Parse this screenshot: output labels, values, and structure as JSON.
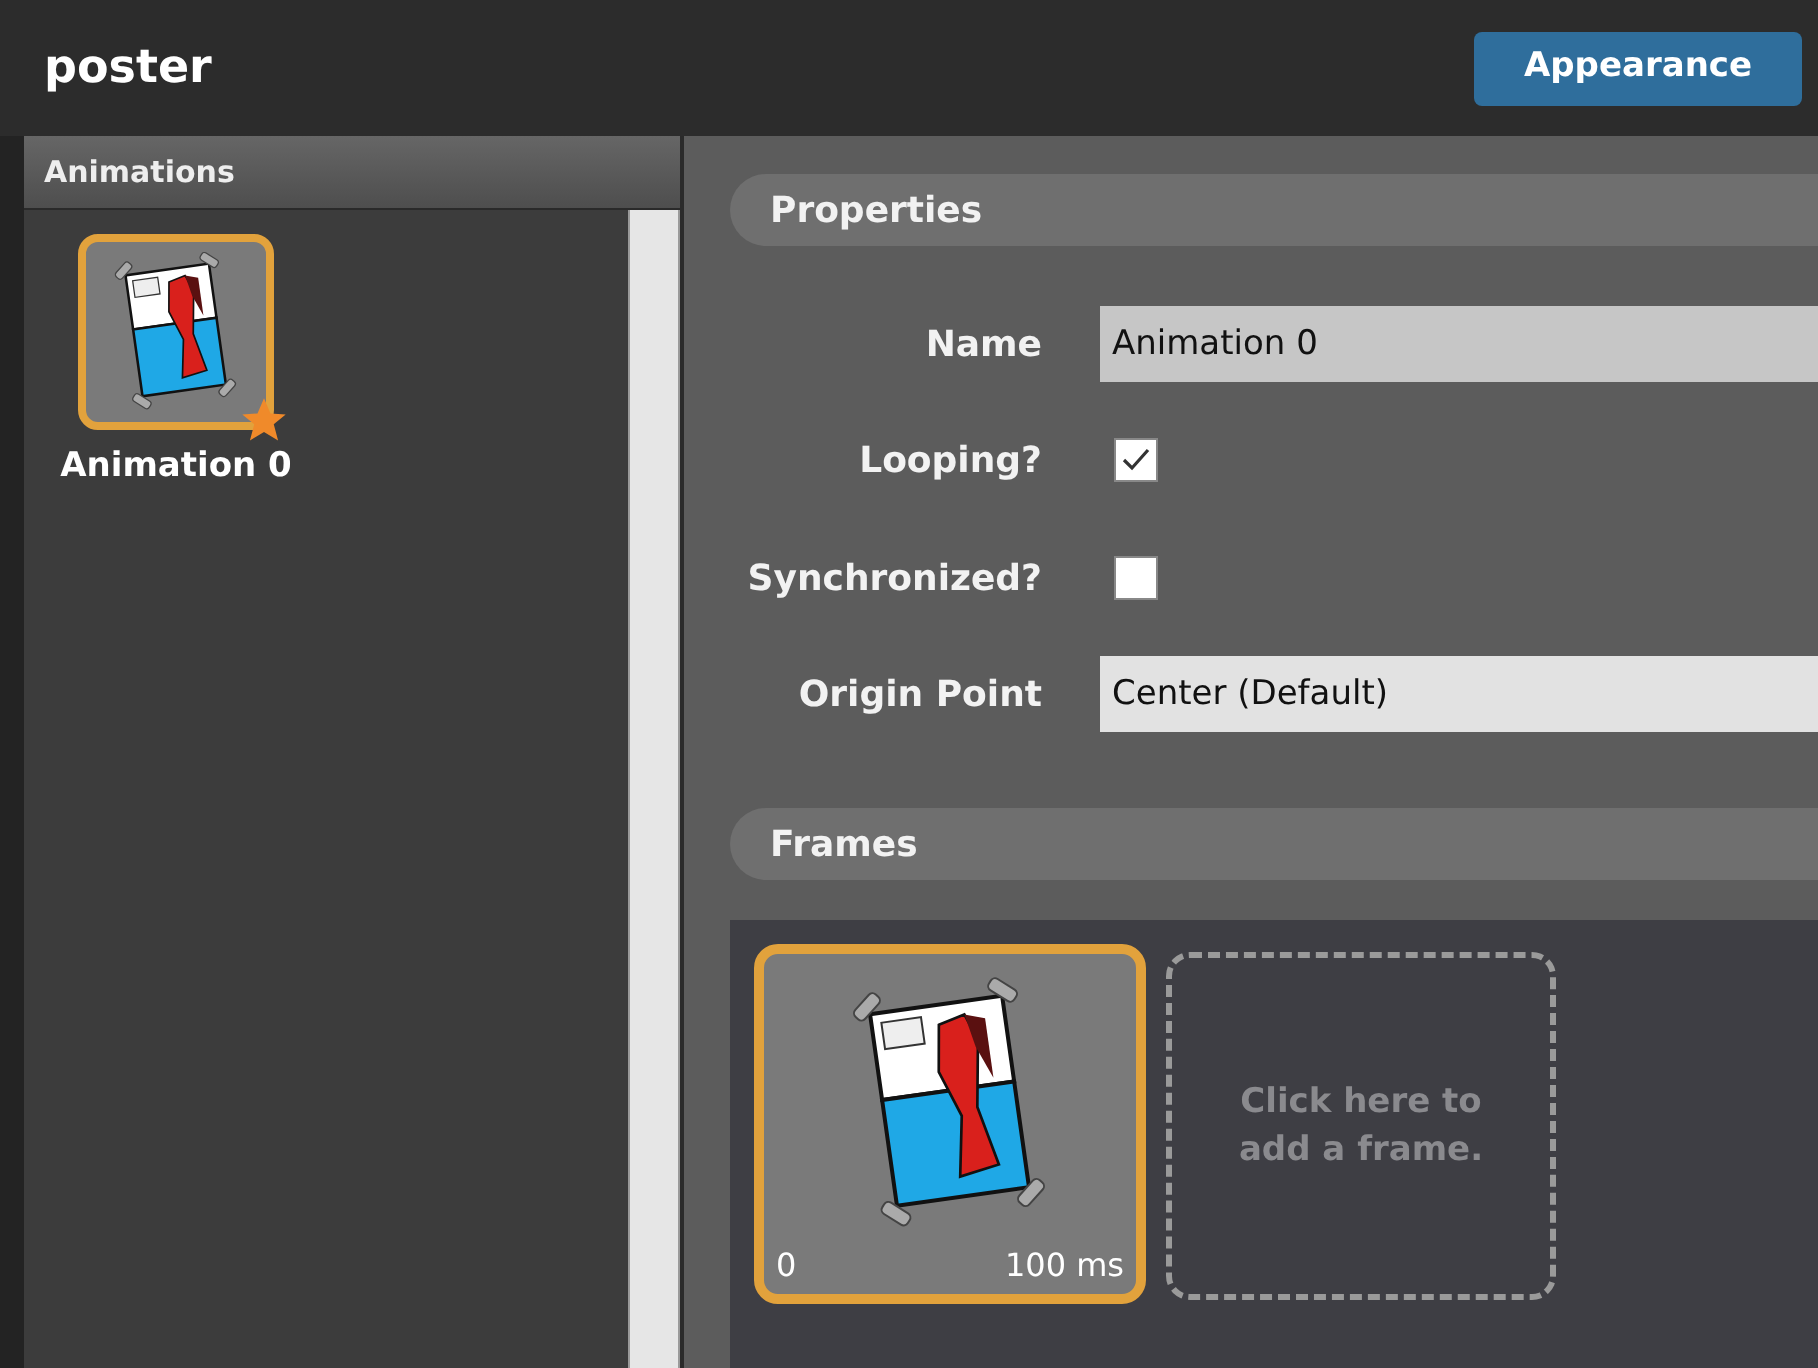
{
  "title": "poster",
  "tabs": [
    {
      "label": "Appearance",
      "selected": true
    }
  ],
  "sidebar": {
    "title": "Animations",
    "items": [
      {
        "label": "Animation 0",
        "selected": true,
        "default": true
      }
    ]
  },
  "properties": {
    "title": "Properties",
    "name": {
      "label": "Name",
      "value": "Animation 0"
    },
    "looping": {
      "label": "Looping?",
      "checked": true
    },
    "synchronized": {
      "label": "Synchronized?",
      "checked": false
    },
    "origin": {
      "label": "Origin Point",
      "value": "Center (Default)"
    }
  },
  "frames": {
    "title": "Frames",
    "items": [
      {
        "index": "0",
        "duration": "100 ms",
        "selected": true
      }
    ],
    "add_hint": "Click here to add a frame."
  }
}
